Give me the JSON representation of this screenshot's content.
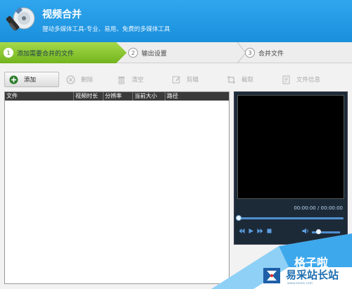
{
  "header": {
    "title": "视频合并",
    "subtitle": "狸动多媒体工具-专业、易用、免费的多媒体工具"
  },
  "steps": [
    {
      "num": "1",
      "label": "添加需要合并的文件"
    },
    {
      "num": "2",
      "label": "输出设置"
    },
    {
      "num": "3",
      "label": "合并文件"
    }
  ],
  "toolbar": {
    "add": "添加",
    "delete": "删除",
    "clear": "清空",
    "cut": "剪辑",
    "crop": "截取",
    "info": "文件信息"
  },
  "filelist": {
    "columns": [
      "文件",
      "视频时长",
      "分辨率",
      "当前大小",
      "路径"
    ]
  },
  "player": {
    "time": "00:00:00 / 00:00:00"
  },
  "watermark": {
    "line1": "格子啦",
    "line2": "易采站长站",
    "line3": "www.easck.com"
  },
  "colors": {
    "header": "#1a8fdc",
    "active_step": "#72b41e"
  }
}
